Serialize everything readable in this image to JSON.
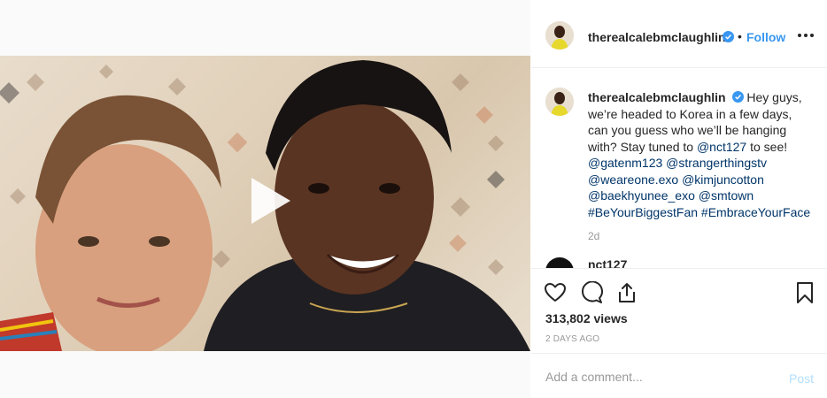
{
  "post": {
    "username": "therealcalebmclaughlin",
    "follow_label": "Follow",
    "separator": "•",
    "verified_icon": "verified-badge-icon",
    "accent_color": "#3897f0"
  },
  "caption": {
    "username": "therealcalebmclaughlin",
    "text_1": " Hey guys, we’re headed to Korea in a few days, can you guess who we’ll be hanging with? Stay tuned to ",
    "mention_nct": "@nct127",
    "text_2": " to see! ",
    "mention_gaten": "@gatenm123",
    "mention_st": "@strangerthingstv",
    "mention_exo": "@weareone.exo",
    "mention_kim": "@kimjuncotton",
    "mention_baek": "@baekhyunee_exo",
    "mention_sm": "@smtown",
    "hashtag_1": "#BeYourBiggestFan",
    "hashtag_2": "#EmbraceYourFace",
    "age": "2d"
  },
  "next_comment": {
    "username": "nct127"
  },
  "stats": {
    "views": "313,802 views",
    "posted": "2 DAYS AGO"
  },
  "comment_box": {
    "placeholder": "Add a comment...",
    "post_label": "Post"
  }
}
